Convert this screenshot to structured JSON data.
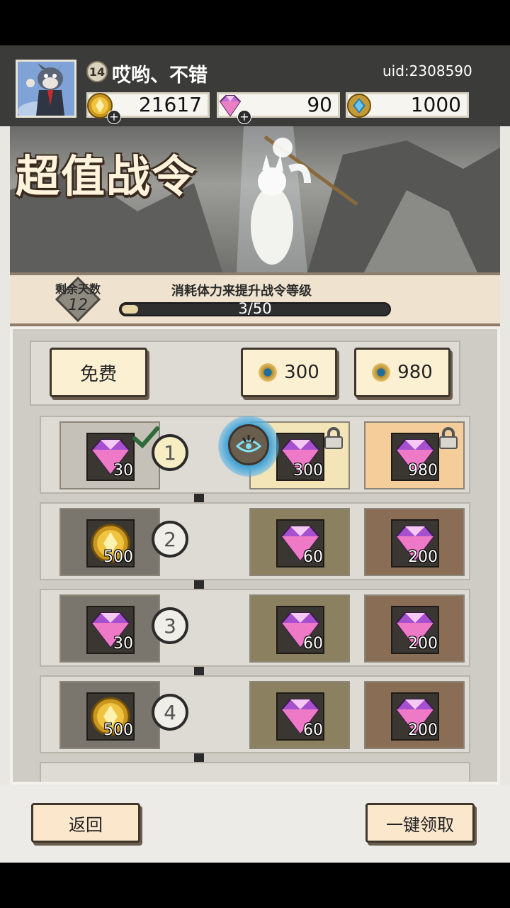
{
  "header": {
    "player_level": "14",
    "player_name": "哎哟、不错",
    "uid": "uid:2308590",
    "currencies": [
      {
        "icon": "gold-coin-icon",
        "value": "21617"
      },
      {
        "icon": "diamond-icon",
        "value": "90"
      },
      {
        "icon": "blue-gem-coin-icon",
        "value": "1000"
      }
    ]
  },
  "banner": {
    "title": "超值战令"
  },
  "progress": {
    "days_label": "剩余天数",
    "days_value": "12",
    "description": "消耗体力来提升战令等级",
    "current": 3,
    "max": 50,
    "text": "3/50"
  },
  "tiers": {
    "free_label": "免费",
    "tier1_price": "300",
    "tier2_price": "980"
  },
  "rows": [
    {
      "level": "1",
      "free": {
        "icon": "diamond-icon",
        "qty": "30",
        "claimed": true
      },
      "t1": {
        "icon": "diamond-icon",
        "qty": "300",
        "locked": true
      },
      "t2": {
        "icon": "diamond-icon",
        "qty": "980",
        "locked": true
      }
    },
    {
      "level": "2",
      "free": {
        "icon": "gold-coin-icon",
        "qty": "500"
      },
      "t1": {
        "icon": "diamond-icon",
        "qty": "60"
      },
      "t2": {
        "icon": "diamond-icon",
        "qty": "200"
      }
    },
    {
      "level": "3",
      "free": {
        "icon": "diamond-icon",
        "qty": "30"
      },
      "t1": {
        "icon": "diamond-icon",
        "qty": "60"
      },
      "t2": {
        "icon": "diamond-icon",
        "qty": "200"
      }
    },
    {
      "level": "4",
      "free": {
        "icon": "gold-coin-icon",
        "qty": "500"
      },
      "t1": {
        "icon": "diamond-icon",
        "qty": "60"
      },
      "t2": {
        "icon": "diamond-icon",
        "qty": "200"
      }
    }
  ],
  "footer": {
    "back_label": "返回",
    "claim_all_label": "一键领取"
  }
}
